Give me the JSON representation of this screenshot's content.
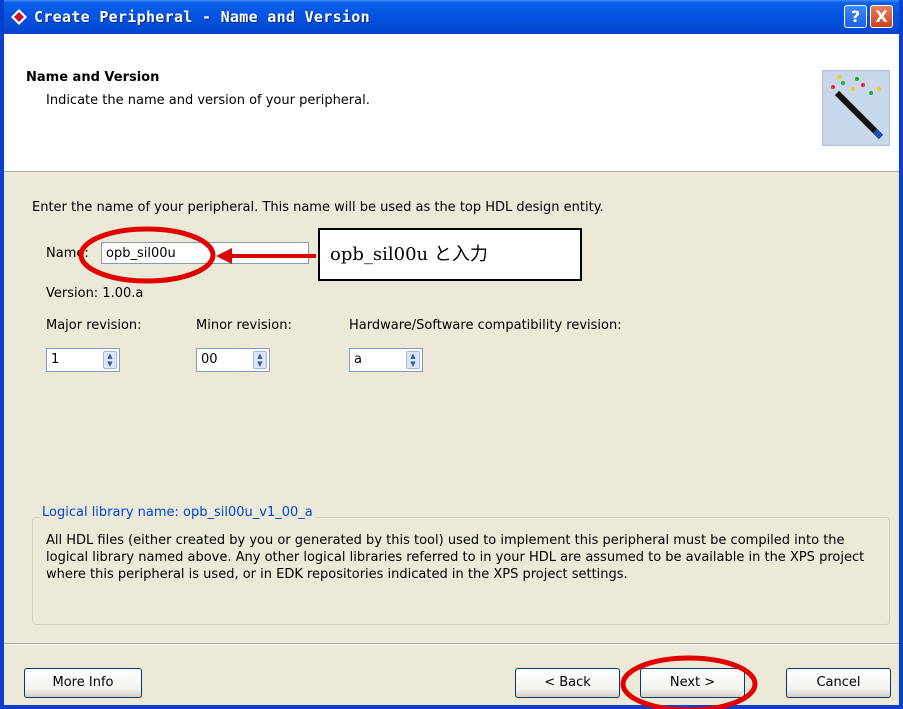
{
  "window": {
    "title": "Create Peripheral - Name and Version",
    "help_label": "?",
    "close_label": "X"
  },
  "header": {
    "title": "Name and Version",
    "subtitle": "Indicate the name and version of your peripheral."
  },
  "form": {
    "intro": "Enter the name of your peripheral. This name will be used as the top HDL design entity.",
    "name_label": "Name:",
    "name_value": "opb_sil00u",
    "version_text": "Version: 1.00.a",
    "major_label": "Major revision:",
    "major_value": "1",
    "minor_label": "Minor revision:",
    "minor_value": "00",
    "hw_sw_label": "Hardware/Software compatibility revision:",
    "hw_sw_value": "a"
  },
  "library": {
    "title": "Logical library name: opb_sil00u_v1_00_a",
    "text": "All HDL files (either created by you or generated by this tool) used to implement this peripheral must be compiled into the logical library named above. Any other logical libraries referred to in your HDL are assumed to be available in the XPS project where this peripheral is used, or in EDK repositories indicated in the XPS project settings."
  },
  "buttons": {
    "more_info": "More Info",
    "back": "< Back",
    "next": "Next >",
    "cancel": "Cancel"
  },
  "annotation": {
    "callout": "opb_sil00u と入力",
    "color": "#e00000"
  },
  "colors": {
    "titlebar": "#0553e0",
    "dialog": "#ece9d8",
    "group_title": "#0046d5"
  }
}
